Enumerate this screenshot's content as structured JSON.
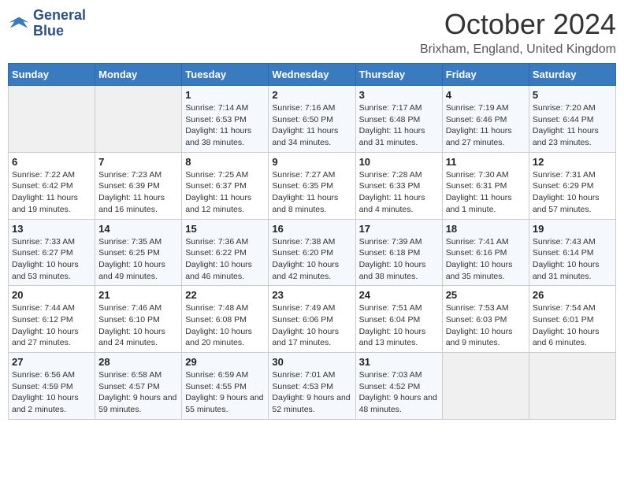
{
  "header": {
    "logo_line1": "General",
    "logo_line2": "Blue",
    "month_title": "October 2024",
    "location": "Brixham, England, United Kingdom"
  },
  "weekdays": [
    "Sunday",
    "Monday",
    "Tuesday",
    "Wednesday",
    "Thursday",
    "Friday",
    "Saturday"
  ],
  "weeks": [
    [
      {
        "day": "",
        "sunrise": "",
        "sunset": "",
        "daylight": "",
        "empty": true
      },
      {
        "day": "",
        "sunrise": "",
        "sunset": "",
        "daylight": "",
        "empty": true
      },
      {
        "day": "1",
        "sunrise": "Sunrise: 7:14 AM",
        "sunset": "Sunset: 6:53 PM",
        "daylight": "Daylight: 11 hours and 38 minutes."
      },
      {
        "day": "2",
        "sunrise": "Sunrise: 7:16 AM",
        "sunset": "Sunset: 6:50 PM",
        "daylight": "Daylight: 11 hours and 34 minutes."
      },
      {
        "day": "3",
        "sunrise": "Sunrise: 7:17 AM",
        "sunset": "Sunset: 6:48 PM",
        "daylight": "Daylight: 11 hours and 31 minutes."
      },
      {
        "day": "4",
        "sunrise": "Sunrise: 7:19 AM",
        "sunset": "Sunset: 6:46 PM",
        "daylight": "Daylight: 11 hours and 27 minutes."
      },
      {
        "day": "5",
        "sunrise": "Sunrise: 7:20 AM",
        "sunset": "Sunset: 6:44 PM",
        "daylight": "Daylight: 11 hours and 23 minutes."
      }
    ],
    [
      {
        "day": "6",
        "sunrise": "Sunrise: 7:22 AM",
        "sunset": "Sunset: 6:42 PM",
        "daylight": "Daylight: 11 hours and 19 minutes."
      },
      {
        "day": "7",
        "sunrise": "Sunrise: 7:23 AM",
        "sunset": "Sunset: 6:39 PM",
        "daylight": "Daylight: 11 hours and 16 minutes."
      },
      {
        "day": "8",
        "sunrise": "Sunrise: 7:25 AM",
        "sunset": "Sunset: 6:37 PM",
        "daylight": "Daylight: 11 hours and 12 minutes."
      },
      {
        "day": "9",
        "sunrise": "Sunrise: 7:27 AM",
        "sunset": "Sunset: 6:35 PM",
        "daylight": "Daylight: 11 hours and 8 minutes."
      },
      {
        "day": "10",
        "sunrise": "Sunrise: 7:28 AM",
        "sunset": "Sunset: 6:33 PM",
        "daylight": "Daylight: 11 hours and 4 minutes."
      },
      {
        "day": "11",
        "sunrise": "Sunrise: 7:30 AM",
        "sunset": "Sunset: 6:31 PM",
        "daylight": "Daylight: 11 hours and 1 minute."
      },
      {
        "day": "12",
        "sunrise": "Sunrise: 7:31 AM",
        "sunset": "Sunset: 6:29 PM",
        "daylight": "Daylight: 10 hours and 57 minutes."
      }
    ],
    [
      {
        "day": "13",
        "sunrise": "Sunrise: 7:33 AM",
        "sunset": "Sunset: 6:27 PM",
        "daylight": "Daylight: 10 hours and 53 minutes."
      },
      {
        "day": "14",
        "sunrise": "Sunrise: 7:35 AM",
        "sunset": "Sunset: 6:25 PM",
        "daylight": "Daylight: 10 hours and 49 minutes."
      },
      {
        "day": "15",
        "sunrise": "Sunrise: 7:36 AM",
        "sunset": "Sunset: 6:22 PM",
        "daylight": "Daylight: 10 hours and 46 minutes."
      },
      {
        "day": "16",
        "sunrise": "Sunrise: 7:38 AM",
        "sunset": "Sunset: 6:20 PM",
        "daylight": "Daylight: 10 hours and 42 minutes."
      },
      {
        "day": "17",
        "sunrise": "Sunrise: 7:39 AM",
        "sunset": "Sunset: 6:18 PM",
        "daylight": "Daylight: 10 hours and 38 minutes."
      },
      {
        "day": "18",
        "sunrise": "Sunrise: 7:41 AM",
        "sunset": "Sunset: 6:16 PM",
        "daylight": "Daylight: 10 hours and 35 minutes."
      },
      {
        "day": "19",
        "sunrise": "Sunrise: 7:43 AM",
        "sunset": "Sunset: 6:14 PM",
        "daylight": "Daylight: 10 hours and 31 minutes."
      }
    ],
    [
      {
        "day": "20",
        "sunrise": "Sunrise: 7:44 AM",
        "sunset": "Sunset: 6:12 PM",
        "daylight": "Daylight: 10 hours and 27 minutes."
      },
      {
        "day": "21",
        "sunrise": "Sunrise: 7:46 AM",
        "sunset": "Sunset: 6:10 PM",
        "daylight": "Daylight: 10 hours and 24 minutes."
      },
      {
        "day": "22",
        "sunrise": "Sunrise: 7:48 AM",
        "sunset": "Sunset: 6:08 PM",
        "daylight": "Daylight: 10 hours and 20 minutes."
      },
      {
        "day": "23",
        "sunrise": "Sunrise: 7:49 AM",
        "sunset": "Sunset: 6:06 PM",
        "daylight": "Daylight: 10 hours and 17 minutes."
      },
      {
        "day": "24",
        "sunrise": "Sunrise: 7:51 AM",
        "sunset": "Sunset: 6:04 PM",
        "daylight": "Daylight: 10 hours and 13 minutes."
      },
      {
        "day": "25",
        "sunrise": "Sunrise: 7:53 AM",
        "sunset": "Sunset: 6:03 PM",
        "daylight": "Daylight: 10 hours and 9 minutes."
      },
      {
        "day": "26",
        "sunrise": "Sunrise: 7:54 AM",
        "sunset": "Sunset: 6:01 PM",
        "daylight": "Daylight: 10 hours and 6 minutes."
      }
    ],
    [
      {
        "day": "27",
        "sunrise": "Sunrise: 6:56 AM",
        "sunset": "Sunset: 4:59 PM",
        "daylight": "Daylight: 10 hours and 2 minutes."
      },
      {
        "day": "28",
        "sunrise": "Sunrise: 6:58 AM",
        "sunset": "Sunset: 4:57 PM",
        "daylight": "Daylight: 9 hours and 59 minutes."
      },
      {
        "day": "29",
        "sunrise": "Sunrise: 6:59 AM",
        "sunset": "Sunset: 4:55 PM",
        "daylight": "Daylight: 9 hours and 55 minutes."
      },
      {
        "day": "30",
        "sunrise": "Sunrise: 7:01 AM",
        "sunset": "Sunset: 4:53 PM",
        "daylight": "Daylight: 9 hours and 52 minutes."
      },
      {
        "day": "31",
        "sunrise": "Sunrise: 7:03 AM",
        "sunset": "Sunset: 4:52 PM",
        "daylight": "Daylight: 9 hours and 48 minutes."
      },
      {
        "day": "",
        "sunrise": "",
        "sunset": "",
        "daylight": "",
        "empty": true
      },
      {
        "day": "",
        "sunrise": "",
        "sunset": "",
        "daylight": "",
        "empty": true
      }
    ]
  ]
}
